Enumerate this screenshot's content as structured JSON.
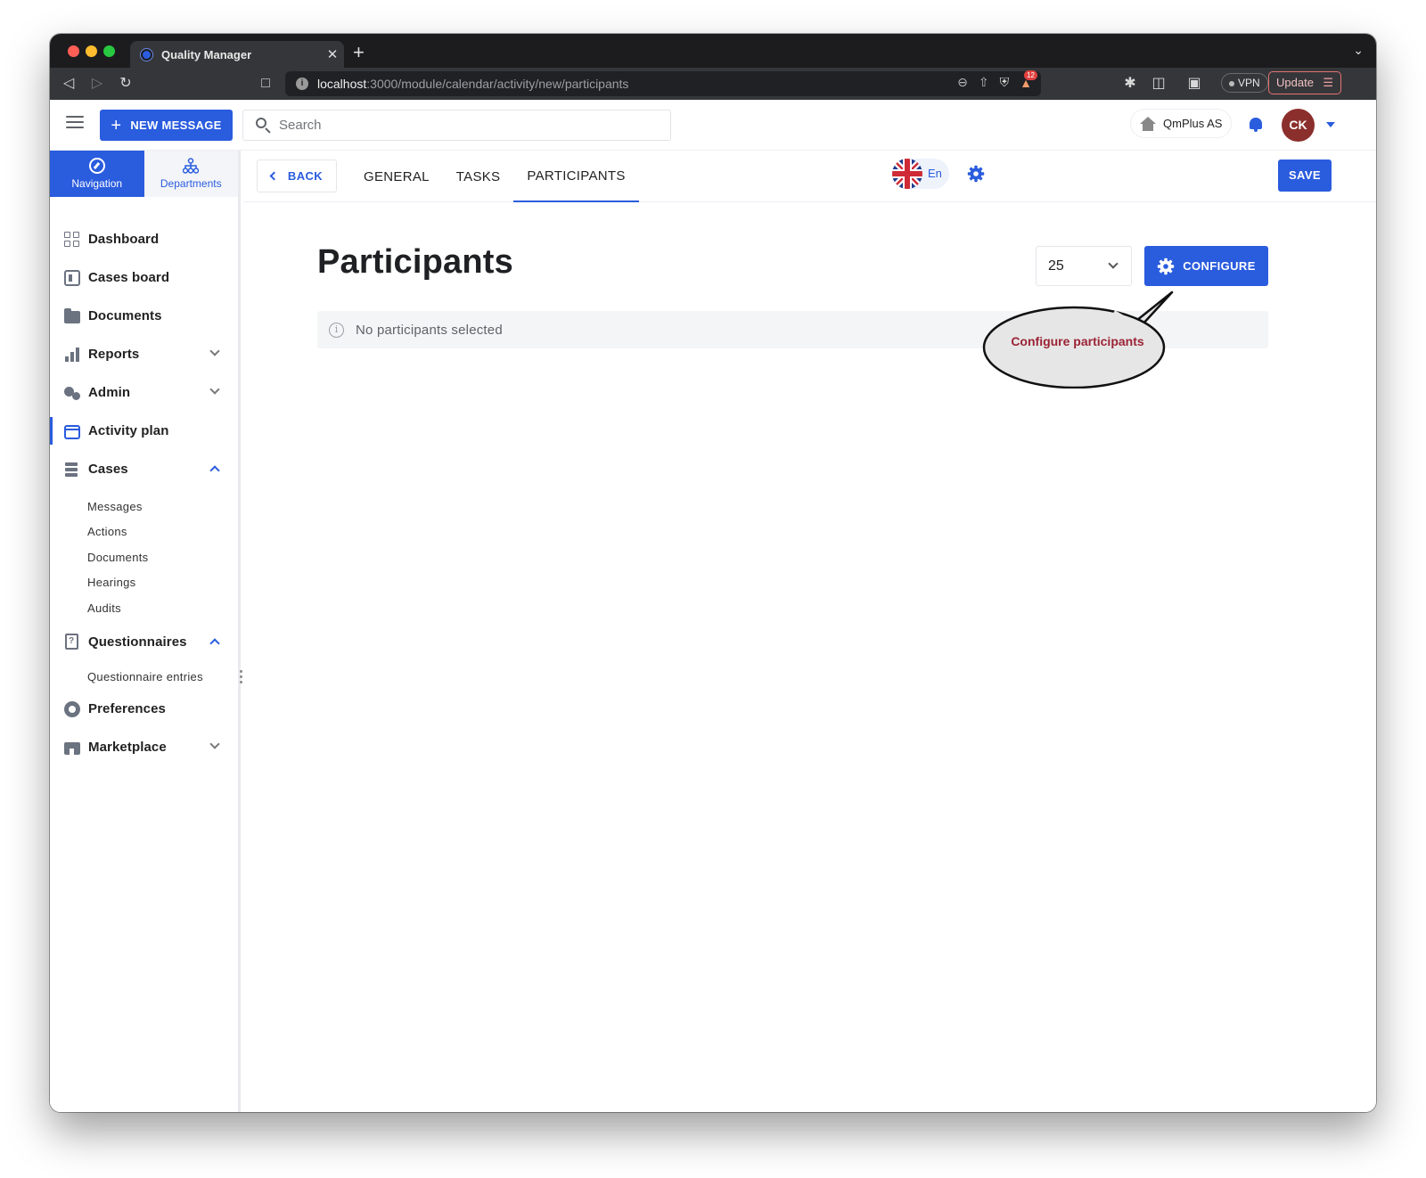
{
  "browser": {
    "tab_title": "Quality Manager",
    "tab_close": "✕",
    "new_tab": "+",
    "url_host": "localhost",
    "url_path": ":3000/module/calendar/activity/new/participants",
    "shields_count": "12",
    "vpn_label": "VPN",
    "update_label": "Update"
  },
  "header": {
    "new_message_label": "NEW MESSAGE",
    "search_placeholder": "Search",
    "company_name": "QmPlus AS",
    "avatar_initials": "CK"
  },
  "sidebar": {
    "tabs": [
      {
        "label": "Navigation",
        "icon": "compass-icon",
        "active": true
      },
      {
        "label": "Departments",
        "icon": "org-chart-icon",
        "active": false
      }
    ],
    "items": [
      {
        "label": "Dashboard",
        "icon": "dashboard-icon"
      },
      {
        "label": "Cases board",
        "icon": "board-icon"
      },
      {
        "label": "Documents",
        "icon": "folder-icon"
      },
      {
        "label": "Reports",
        "icon": "bar-chart-icon",
        "expandable": true
      },
      {
        "label": "Admin",
        "icon": "gears-icon",
        "expandable": true
      },
      {
        "label": "Activity plan",
        "icon": "calendar-icon",
        "active": true
      },
      {
        "label": "Cases",
        "icon": "cases-icon",
        "expanded": true
      },
      {
        "label": "Questionnaires",
        "icon": "clipboard-icon",
        "expanded": true
      },
      {
        "label": "Preferences",
        "icon": "gear-icon"
      },
      {
        "label": "Marketplace",
        "icon": "store-icon",
        "expandable": true
      }
    ],
    "cases_children": [
      "Messages",
      "Actions",
      "Documents",
      "Hearings",
      "Audits"
    ],
    "questionnaire_children": [
      "Questionnaire entries"
    ]
  },
  "subheader": {
    "back_label": "BACK",
    "tabs": [
      "GENERAL",
      "TASKS",
      "PARTICIPANTS"
    ],
    "active_tab": "PARTICIPANTS",
    "language_label": "En",
    "save_label": "SAVE"
  },
  "content": {
    "title": "Participants",
    "page_size": "25",
    "configure_label": "CONFIGURE",
    "empty_message": "No participants selected",
    "callout_text": "Configure participants"
  },
  "colors": {
    "primary": "#2a5cde",
    "avatar": "#8b2f2c",
    "callout_text": "#9b2335"
  }
}
